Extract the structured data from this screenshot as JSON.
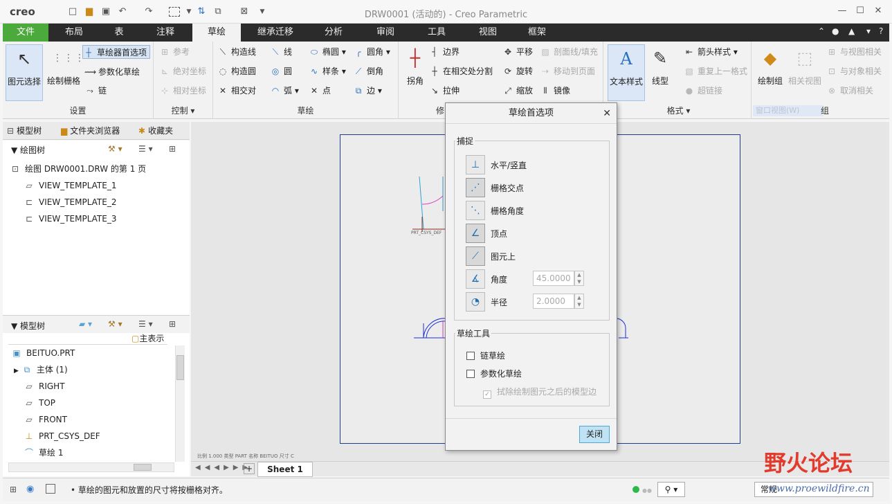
{
  "titlebar": {
    "logo": "creo",
    "window_title": "DRW0001 (活动的) - Creo Parametric"
  },
  "tabs": [
    "文件",
    "布局",
    "表",
    "注释",
    "草绘",
    "继承迁移",
    "分析",
    "审阅",
    "工具",
    "视图",
    "框架"
  ],
  "active_tab": "草绘",
  "ribbon": {
    "setup": {
      "label": "设置",
      "select": "图元选择",
      "grid": "绘制栅格",
      "sketcher_prefs": "草绘器首选项",
      "param_sketch": "参数化草绘",
      "chain": "链"
    },
    "control": {
      "label": "控制",
      "reference": "参考",
      "abs_coord": "绝对坐标",
      "rel_coord": "相对坐标"
    },
    "sketch": {
      "label": "草绘",
      "construction_line": "构造线",
      "construction_circle": "构造圆",
      "intersect": "相交对",
      "line": "线",
      "circle": "圆",
      "arc": "弧",
      "ellipse": "椭圆",
      "spline": "样条",
      "point": "点",
      "fillet": "圆角",
      "chamfer": "倒角",
      "edge": "边"
    },
    "modify": {
      "label": "修",
      "corner": "拐角",
      "boundary": "边界",
      "split_at_intersect": "在相交处分割",
      "stretch": "拉伸",
      "translate": "平移",
      "rotate": "旋转",
      "scale": "缩放",
      "section_fill": "剖面线/填充",
      "move_to_page": "移动到页面",
      "mirror": "镜像"
    },
    "format": {
      "label": "格式",
      "text_style": "文本样式",
      "line_style": "线型",
      "arrow_style": "箭头样式",
      "repeat_format": "重复上一格式",
      "hyperlink": "超链接"
    },
    "group": {
      "label": "组",
      "draw_group": "绘制组",
      "related_view": "相关视图",
      "relate_to_view": "与视图相关",
      "relate_to_object": "与对象相关",
      "unrelate": "取消相关",
      "window_view": "窗口视图(W)"
    }
  },
  "left_panel": {
    "tabs": [
      "模型树",
      "文件夹浏览器",
      "收藏夹"
    ],
    "drawing_tree_header": "绘图树",
    "drawing_items": [
      "绘图 DRW0001.DRW 的第 1 页",
      "VIEW_TEMPLATE_1",
      "VIEW_TEMPLATE_2",
      "VIEW_TEMPLATE_3"
    ],
    "model_tree_header": "模型树",
    "column_header": "主表示",
    "model_items": [
      "BEITUO.PRT",
      "主体 (1)",
      "RIGHT",
      "TOP",
      "FRONT",
      "PRT_CSYS_DEF",
      "草绘 1"
    ]
  },
  "canvas": {
    "csys_label": "PRT_CSYS_DEF",
    "scale_info": "比例 1.000   类型 PART   名称 BEITUO   尺寸 C",
    "sheet_tab": "Sheet 1"
  },
  "status_bar": {
    "message": "草绘的图元和放置的尺寸将按栅格对齐。",
    "filter": "常规"
  },
  "dialog": {
    "title": "草绘首选项",
    "snap_label": "捕捉",
    "snaps": [
      "水平/竖直",
      "栅格交点",
      "栅格角度",
      "顶点",
      "图元上"
    ],
    "angle_label": "角度",
    "angle_value": "45.0000",
    "radius_label": "半径",
    "radius_value": "2.0000",
    "tools_label": "草绘工具",
    "chain_sketch": "链草绘",
    "param_sketch": "参数化草绘",
    "erase_edges": "拭除绘制图元之后的模型边",
    "close": "关闭"
  },
  "watermark": {
    "text": "野火论坛",
    "url": "www.proewildfire.cn"
  },
  "colors": {
    "file_tab": "#4caa3c",
    "tab_bar": "#2b2b2b",
    "sheet_border": "#1b3f8f",
    "annotation": "#1a2fd6",
    "close_button": "#bfe3f5",
    "watermark": "#e23a2c"
  }
}
